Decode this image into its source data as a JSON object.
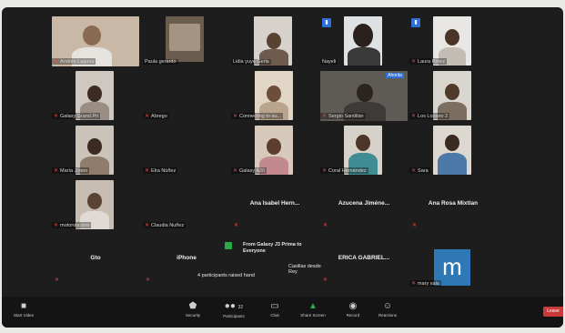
{
  "participants": [
    {
      "name": "Andrés Laguna"
    },
    {
      "name": "Paula gerardo"
    },
    {
      "name": "Lidia yuye Gerla"
    },
    {
      "name": "Nayeli"
    },
    {
      "name": "Laura Pérez"
    },
    {
      "name": "Galaxy Grand Pri"
    },
    {
      "name": "Abrego"
    },
    {
      "name": "Connecting to au..."
    },
    {
      "name": "Sergio Santillán",
      "tag": "Ahorita"
    },
    {
      "name": "Los Lozano 2"
    },
    {
      "name": "María Jimen"
    },
    {
      "name": "Elra Núñez"
    },
    {
      "name": "Galaxy A20"
    },
    {
      "name": "Coral Hernández"
    },
    {
      "name": "Sara"
    },
    {
      "name": "motorola one"
    },
    {
      "name": "Claudia Nuñez"
    },
    {
      "name": "Ana Isabel Hern..."
    },
    {
      "name": "Azucena Jiméne..."
    },
    {
      "name": "Ana Rosa Mixtlan"
    },
    {
      "name": "Gto"
    },
    {
      "name": "iPhone"
    },
    {
      "name": "ERICA GABRIEL..."
    },
    {
      "name": "mary sala",
      "avatar_letter": "m"
    }
  ],
  "chat": {
    "from": "From Galaxy J3 Prima to Everyone",
    "sender": "Casillas desde Rey",
    "raised": "4 participants raised hand"
  },
  "toolbar": {
    "start_video": "Start Video",
    "security": "Security",
    "participants": "Participants",
    "participants_count": "32",
    "chat": "Chat",
    "share": "Share Screen",
    "record": "Record",
    "reactions": "Reactions",
    "end": "Leave"
  },
  "colors": {
    "background": "#1c1d1c",
    "mute": "#e54b4b",
    "share": "#2aa84a",
    "avatar": "#2d78b5"
  }
}
